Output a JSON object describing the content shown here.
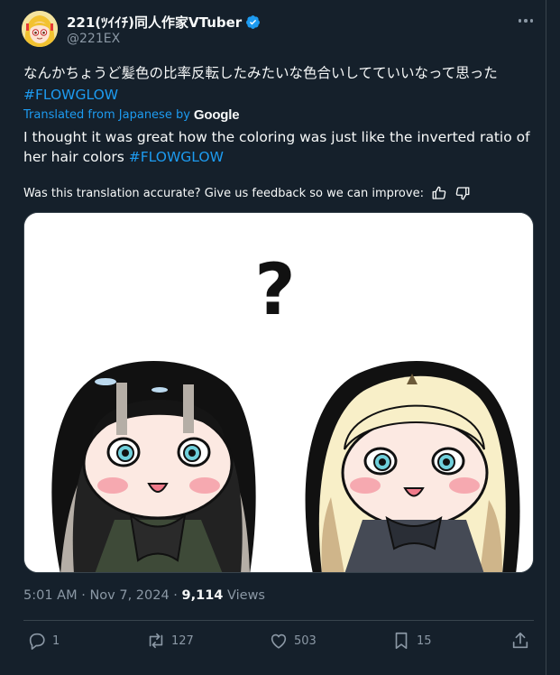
{
  "author": {
    "display_name": "221(ﾂｲｲﾁ)同人作家VTuber",
    "handle": "@221EX",
    "verified_color": "#1d9bf0"
  },
  "tweet": {
    "original_text": "なんかちょうど髪色の比率反転したみたいな色合いしてていいなって思った　",
    "original_hashtag": "#FLOWGLOW",
    "translated_by_label": "Translated from Japanese by",
    "translated_by_brand": "Google",
    "translated_text": "I thought it was great how the coloring was just like the inverted ratio of her hair colors ",
    "translated_hashtag": "#FLOWGLOW",
    "feedback_prompt": "Was this translation accurate? Give us feedback so we can improve:",
    "media_question_mark": "?"
  },
  "meta": {
    "time": "5:01 AM",
    "separator": " · ",
    "date": "Nov 7, 2024",
    "separator2": " · ",
    "views_count": "9,114",
    "views_label": " Views"
  },
  "actions": {
    "replies": "1",
    "reposts": "127",
    "likes": "503",
    "bookmarks": "15"
  },
  "icons": {
    "verified": "verified-badge-icon",
    "more": "more-dots-icon",
    "thumbs_up": "thumbs-up-icon",
    "thumbs_down": "thumbs-down-icon",
    "reply": "reply-icon",
    "repost": "repost-icon",
    "like": "heart-icon",
    "bookmark": "bookmark-icon",
    "share": "share-icon"
  },
  "colors": {
    "background": "#15202b",
    "text": "#f7f9f9",
    "secondary": "#8b98a5",
    "accent": "#1d9bf0",
    "border": "#38444d"
  }
}
